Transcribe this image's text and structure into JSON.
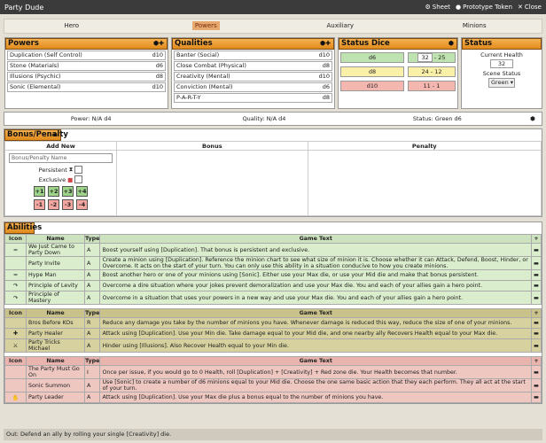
{
  "window": {
    "title": "Party Dude",
    "sheet": "Sheet",
    "prototype": "Prototype Token",
    "close": "Close"
  },
  "tabs": [
    "Hero",
    "Powers",
    "Auxiliary",
    "Minions"
  ],
  "active_tab": "Powers",
  "powers": {
    "title": "Powers",
    "items": [
      {
        "name": "Duplication (Self Control)",
        "die": "d10"
      },
      {
        "name": "Stone (Materials)",
        "die": "d6"
      },
      {
        "name": "Illusions (Psychic)",
        "die": "d8"
      },
      {
        "name": "Sonic (Elemental)",
        "die": "d10"
      }
    ]
  },
  "qualities": {
    "title": "Qualities",
    "items": [
      {
        "name": "Banter (Social)",
        "die": "d10"
      },
      {
        "name": "Close Combat (Physical)",
        "die": "d8"
      },
      {
        "name": "Creativity (Mental)",
        "die": "d10"
      },
      {
        "name": "Conviction (Mental)",
        "die": "d6"
      },
      {
        "name": "P-A-R-T-Y",
        "die": "d8"
      }
    ]
  },
  "status_dice": {
    "title": "Status Dice",
    "rows": [
      {
        "die": "d6",
        "min": "32",
        "range": " - 25"
      },
      {
        "die": "d8",
        "range": "24 - 12"
      },
      {
        "die": "d10",
        "range": "11 - 1"
      }
    ]
  },
  "status": {
    "title": "Status",
    "current_health_label": "Current Health",
    "current_health": "32",
    "scene_label": "Scene Status",
    "scene_value": "Green"
  },
  "summary": {
    "power": "Power: N/A d4",
    "quality": "Quality: N/A d4",
    "status": "Status: Green d6"
  },
  "bp": {
    "title": "Bonus/Penalty",
    "add_new": "Add New",
    "bonus": "Bonus",
    "penalty": "Penalty",
    "placeholder": "Bonus/Penalty Name",
    "persistent": "Persistent",
    "exclusive": "Exclusive",
    "plus": [
      "+1",
      "+2",
      "+3",
      "+4"
    ],
    "minus": [
      "-1",
      "-2",
      "-3",
      "-4"
    ]
  },
  "abilities": {
    "title": "Abilities",
    "headers": {
      "icon": "Icon",
      "name": "Name",
      "type": "Type",
      "text": "Game Text",
      "add": "+"
    },
    "green": [
      {
        "icon": "≈",
        "name": "We Just Came to Party Down",
        "type": "A",
        "text": "Boost yourself using [Duplication]. That bonus is persistent and exclusive."
      },
      {
        "icon": "",
        "name": "Party Invite",
        "type": "A",
        "text": "Create a minion using [Duplication]. Reference the minion chart to see what size of minion it is. Choose whether it can Attack, Defend, Boost, Hinder, or Overcome. It acts on the start of your turn. You can only use this ability in a situation conducive to how you create minions."
      },
      {
        "icon": "≈",
        "name": "Hype Man",
        "type": "A",
        "text": "Boost another hero or one of your minions using [Sonic]. Either use your Max die, or use your Mid die and make that bonus persistent."
      },
      {
        "icon": "↷",
        "name": "Principle of Levity",
        "type": "A",
        "text": "Overcome a dire situation where your jokes prevent demoralization and use your Max die. You and each of your allies gain a hero point."
      },
      {
        "icon": "↷",
        "name": "Principle of Mastery",
        "type": "A",
        "text": "Overcome in a situation that uses your powers in a new way and use your Max die. You and each of your allies gain a hero point."
      }
    ],
    "yellow": [
      {
        "icon": "",
        "name": "Bros Before KOs",
        "type": "R",
        "text": "Reduce any damage you take by the number of minions you have. Whenever damage is reduced this way, reduce the size of one of your minions."
      },
      {
        "icon": "✚",
        "name": "Party Healer",
        "type": "A",
        "text": "Attack using [Duplication]. Use your Min die. Take damage equal to your Mid die, and one nearby ally Recovers Health equal to your Max die."
      },
      {
        "icon": "⚔",
        "name": "Party Tricks Michael",
        "type": "A",
        "text": "Hinder using [Illusions]. Also Recover Health equal to your Min die."
      }
    ],
    "red": [
      {
        "icon": "",
        "name": "The Party Must Go On",
        "type": "I",
        "text": "Once per issue, if you would go to 0 Health, roll [Duplication] + [Creativity] + Red zone die. Your Health becomes that number."
      },
      {
        "icon": "",
        "name": "Sonic Summon",
        "type": "A",
        "text": "Use [Sonic] to create a number of d6 minions equal to your Mid die. Choose the one same basic action that they each perform. They all act at the start of your turn."
      },
      {
        "icon": "✋",
        "name": "Party Leader",
        "type": "A",
        "text": "Attack using [Duplication]. Use your Max die plus a bonus equal to the number of minions you have."
      }
    ]
  },
  "out": "Out: Defend an ally by rolling your single [Creativity] die."
}
